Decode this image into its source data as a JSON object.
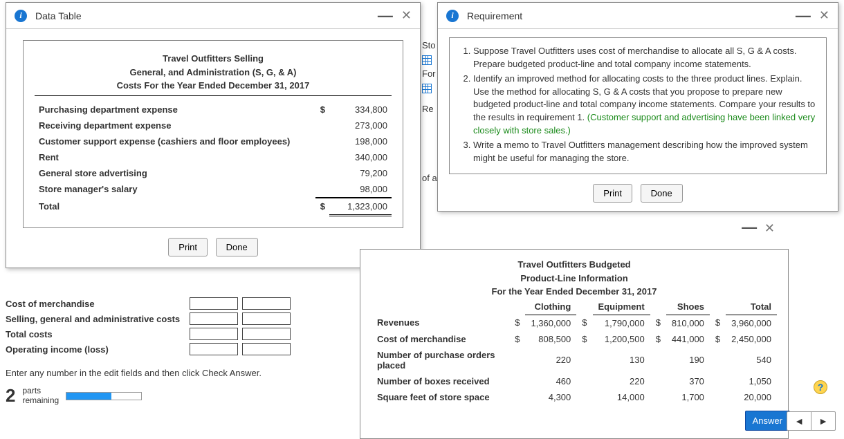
{
  "data_table": {
    "title": "Data Table",
    "header1": "Travel Outfitters Selling",
    "header2": "General, and Administration (S, G, & A)",
    "header3": "Costs For the Year Ended December 31, 2017",
    "currency": "$",
    "rows": [
      {
        "label": "Purchasing department expense",
        "value": "334,800"
      },
      {
        "label": "Receiving department expense",
        "value": "273,000"
      },
      {
        "label": "Customer support expense (cashiers and floor employees)",
        "value": "198,000"
      },
      {
        "label": "Rent",
        "value": "340,000"
      },
      {
        "label": "General store advertising",
        "value": "79,200"
      },
      {
        "label": "Store manager's salary",
        "value": "98,000"
      }
    ],
    "total_label": "Total",
    "total_value": "1,323,000",
    "print": "Print",
    "done": "Done"
  },
  "requirement": {
    "title": "Requirement",
    "items": [
      {
        "text": "Suppose Travel Outfitters uses cost of merchandise to allocate all S, G & A costs. Prepare budgeted product-line and total company income statements."
      },
      {
        "text": "Identify an improved method for allocating costs to the three product lines. Explain. Use the method for allocating S, G & A costs that you propose to prepare new budgeted product-line and total company income statements. Compare your results to the results in requirement 1. ",
        "extra": "(Customer support and advertising have been linked very closely with store sales.)"
      },
      {
        "text": "Write a memo to Travel Outfitters management describing how the improved system might be useful for managing the store."
      }
    ],
    "print": "Print",
    "done": "Done"
  },
  "bg": {
    "sto": "Sto",
    "for": "For",
    "re": "Re",
    "of_allo": "of allo"
  },
  "worksheet": {
    "rows": [
      "Cost of merchandise",
      "Selling, general and administrative costs",
      "Total costs",
      "Operating income (loss)"
    ],
    "instruction": "Enter any number in the edit fields and then click Check Answer.",
    "parts_num": "2",
    "parts_label": "parts\nremaining"
  },
  "budget": {
    "h1": "Travel Outfitters Budgeted",
    "h2": "Product-Line Information",
    "h3": "For the Year Ended December 31, 2017",
    "cols": [
      "Clothing",
      "Equipment",
      "Shoes",
      "Total"
    ],
    "rows": [
      {
        "label": "Revenues",
        "cur": "$",
        "vals": [
          "1,360,000",
          "1,790,000",
          "810,000",
          "3,960,000"
        ],
        "curcols": true
      },
      {
        "label": "Cost of merchandise",
        "cur": "$",
        "vals": [
          "808,500",
          "1,200,500",
          "441,000",
          "2,450,000"
        ],
        "curcols": true
      },
      {
        "label": "Number of purchase orders placed",
        "vals": [
          "220",
          "130",
          "190",
          "540"
        ]
      },
      {
        "label": "Number of boxes received",
        "vals": [
          "460",
          "220",
          "370",
          "1,050"
        ]
      },
      {
        "label": "Square feet of store space",
        "vals": [
          "4,300",
          "14,000",
          "1,700",
          "20,000"
        ]
      }
    ]
  },
  "footer": {
    "answer": "Answer",
    "help": "?"
  },
  "chart_data": {
    "type": "table",
    "tables": [
      {
        "title": "Travel Outfitters Selling, General, and Administration (S, G, & A) Costs For the Year Ended December 31, 2017",
        "rows": [
          {
            "item": "Purchasing department expense",
            "amount": 334800
          },
          {
            "item": "Receiving department expense",
            "amount": 273000
          },
          {
            "item": "Customer support expense (cashiers and floor employees)",
            "amount": 198000
          },
          {
            "item": "Rent",
            "amount": 340000
          },
          {
            "item": "General store advertising",
            "amount": 79200
          },
          {
            "item": "Store manager's salary",
            "amount": 98000
          },
          {
            "item": "Total",
            "amount": 1323000
          }
        ]
      },
      {
        "title": "Travel Outfitters Budgeted Product-Line Information For the Year Ended December 31, 2017",
        "columns": [
          "Clothing",
          "Equipment",
          "Shoes",
          "Total"
        ],
        "rows": [
          {
            "metric": "Revenues",
            "values": [
              1360000,
              1790000,
              810000,
              3960000
            ]
          },
          {
            "metric": "Cost of merchandise",
            "values": [
              808500,
              1200500,
              441000,
              2450000
            ]
          },
          {
            "metric": "Number of purchase orders placed",
            "values": [
              220,
              130,
              190,
              540
            ]
          },
          {
            "metric": "Number of boxes received",
            "values": [
              460,
              220,
              370,
              1050
            ]
          },
          {
            "metric": "Square feet of store space",
            "values": [
              4300,
              14000,
              1700,
              20000
            ]
          }
        ]
      }
    ]
  }
}
